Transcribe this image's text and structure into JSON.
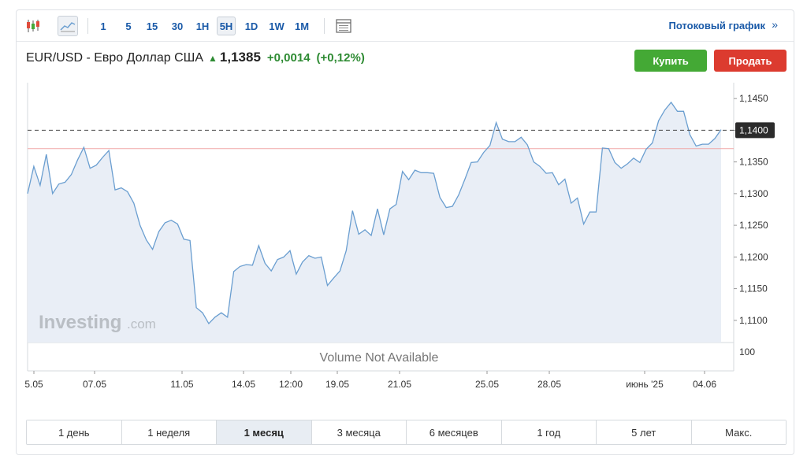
{
  "toolbar": {
    "candles_icon": "candlestick-icon",
    "line_icon": "line-chart-icon",
    "intervals": [
      "1",
      "5",
      "15",
      "30",
      "1H",
      "5H",
      "1D",
      "1W",
      "1M"
    ],
    "active_interval": "5H",
    "table_icon": "table-icon",
    "stream_label": "Потоковый график",
    "stream_arrow": "»"
  },
  "header": {
    "title": "EUR/USD - Евро Доллар США",
    "arrow": "▲",
    "price": "1,1385",
    "change": "+0,0014",
    "change_pct": "(+0,12%)",
    "up_color": "#2e8b33"
  },
  "buttons": {
    "buy": "Купить",
    "sell": "Продать"
  },
  "chart_data": {
    "type": "area",
    "y_ticks": [
      "1,1450",
      "1,1400",
      "1,1350",
      "1,1300",
      "1,1250",
      "1,1200",
      "1,1150",
      "1,1100"
    ],
    "current_label": "1,1400",
    "reference_level": 1.14,
    "previous_close_level": 1.1371,
    "ylim": [
      1.1065,
      1.1485
    ],
    "volume_label": "Volume Not Available",
    "volume_tick": "100",
    "watermark_main": "Investing",
    "watermark_suffix": ".com",
    "x_labels": [
      "5.05",
      "07.05",
      "11.05",
      "14.05",
      "12:00",
      "19.05",
      "21.05",
      "25.05",
      "28.05",
      "июнь '25",
      "04.06"
    ],
    "values": [
      1.13,
      1.1343,
      1.1313,
      1.1362,
      1.13,
      1.1315,
      1.1318,
      1.133,
      1.1353,
      1.1373,
      1.134,
      1.1345,
      1.1357,
      1.1368,
      1.1306,
      1.1309,
      1.1303,
      1.1285,
      1.125,
      1.1227,
      1.1212,
      1.124,
      1.1254,
      1.1258,
      1.1252,
      1.1228,
      1.1226,
      1.112,
      1.1112,
      1.1095,
      1.1105,
      1.1112,
      1.1105,
      1.1177,
      1.1185,
      1.1188,
      1.1187,
      1.1218,
      1.119,
      1.1178,
      1.1196,
      1.12,
      1.121,
      1.1173,
      1.1192,
      1.1202,
      1.1198,
      1.12,
      1.1155,
      1.1167,
      1.1178,
      1.121,
      1.1273,
      1.1236,
      1.1243,
      1.1234,
      1.1276,
      1.1235,
      1.1276,
      1.1283,
      1.1335,
      1.1322,
      1.1337,
      1.1333,
      1.1333,
      1.1332,
      1.1294,
      1.1278,
      1.128,
      1.1298,
      1.1323,
      1.1349,
      1.135,
      1.1365,
      1.1376,
      1.1412,
      1.1386,
      1.1382,
      1.1382,
      1.1389,
      1.1377,
      1.135,
      1.1343,
      1.1332,
      1.1333,
      1.1314,
      1.1323,
      1.1285,
      1.1293,
      1.1252,
      1.1271,
      1.1271,
      1.1372,
      1.1371,
      1.1349,
      1.134,
      1.1347,
      1.1356,
      1.1349,
      1.137,
      1.138,
      1.1415,
      1.1432,
      1.1444,
      1.143,
      1.143,
      1.1393,
      1.1375,
      1.1378,
      1.1378,
      1.1387,
      1.1401
    ],
    "line_color": "#6a9ed0",
    "fill_color": "#e9eef6",
    "ref_line_color": "#444444",
    "close_line_color": "#f0a7a7"
  },
  "ranges": [
    "1 день",
    "1 неделя",
    "1 месяц",
    "3 месяца",
    "6 месяцев",
    "1 год",
    "5 лет",
    "Макс."
  ],
  "active_range": "1 месяц"
}
